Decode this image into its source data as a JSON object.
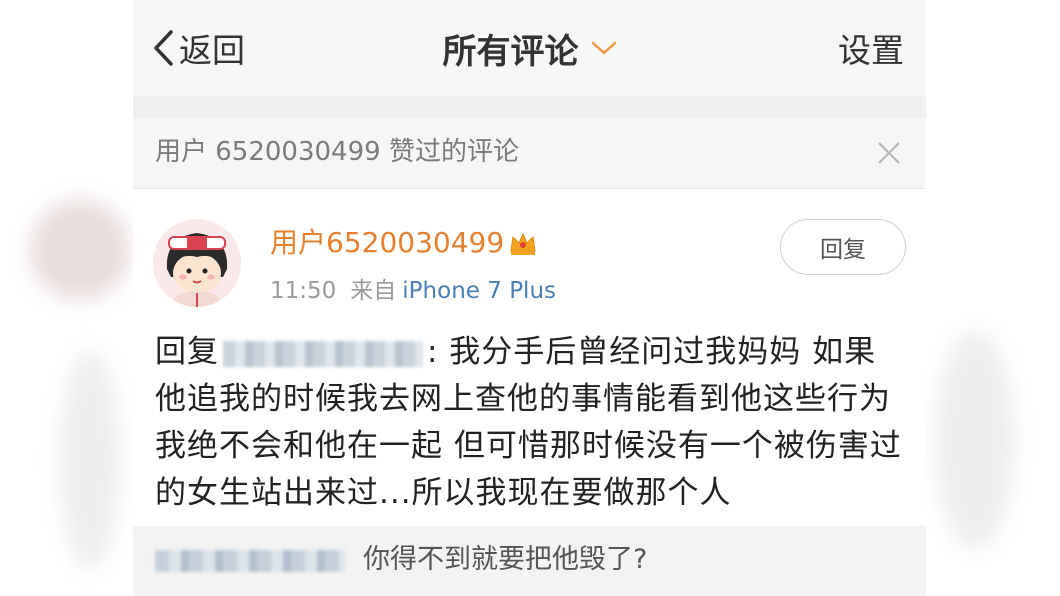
{
  "nav": {
    "back_label": "返回",
    "title": "所有评论",
    "settings_label": "设置"
  },
  "filter": {
    "text": "用户 6520030499 赞过的评论"
  },
  "comment": {
    "username": "用户6520030499",
    "time": "11:50",
    "from_label": "来自",
    "device": "iPhone 7 Plus",
    "reply_button": "回复",
    "reply_prefix": "回复",
    "body_line1_rest": ": 我分手后曾经问过我妈妈 如果",
    "body_rest": "他追我的时候我去网上查他的事情能看到他这些行为我绝不会和他在一起 但可惜那时候没有一个被伤害过的女生站出来过...所以我现在要做那个人"
  },
  "sub_reply": {
    "text": "你得不到就要把他毁了?"
  },
  "colors": {
    "username": "#e8812f",
    "device_link": "#4a7fb8",
    "nav_bg": "#f7f7f7",
    "filter_bg": "#f6f6f6"
  },
  "icons": {
    "back": "chevron-left-icon",
    "title_dropdown": "chevron-down-icon",
    "close": "close-icon",
    "vip": "crown-icon"
  }
}
